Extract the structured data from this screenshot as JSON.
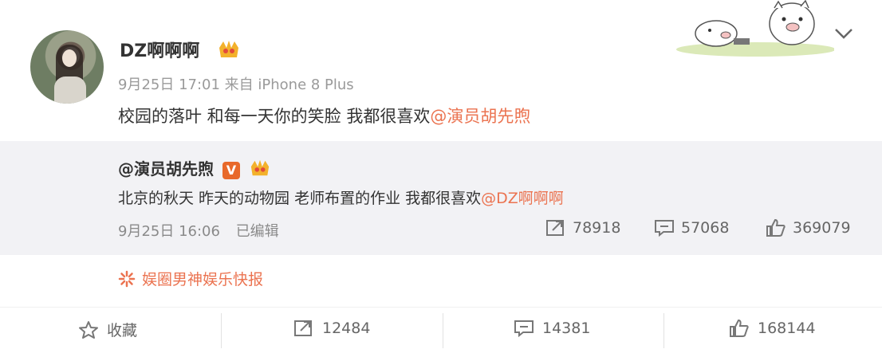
{
  "post": {
    "username": "DZ啊啊啊",
    "meta": "9月25日 17:01 来自 iPhone 8 Plus",
    "content_text": "校园的落叶 和每一天你的笑脸 我都很喜欢",
    "content_mention": "@演员胡先煦"
  },
  "quoted": {
    "username": "@演员胡先煦",
    "verified_badge": "V",
    "text": "北京的秋天 昨天的动物园 老师布置的作业 我都很喜欢",
    "mention": "@DZ啊啊啊",
    "time": "9月25日 16:06",
    "edited": "已编辑",
    "reposts": "78918",
    "comments": "57068",
    "likes": "369079"
  },
  "source": {
    "label": "娱圈男神娱乐快报"
  },
  "actions": {
    "favorite": "收藏",
    "reposts": "12484",
    "comments": "14381",
    "likes": "168144"
  },
  "colors": {
    "accent": "#eb7350",
    "quoted_bg": "#f2f2f5",
    "vip_orange": "#e8692a"
  },
  "icons": [
    "crown-icon",
    "chevron-down-icon",
    "repost-icon",
    "comment-icon",
    "like-icon",
    "star-icon",
    "source-icon",
    "pig-sticker"
  ]
}
